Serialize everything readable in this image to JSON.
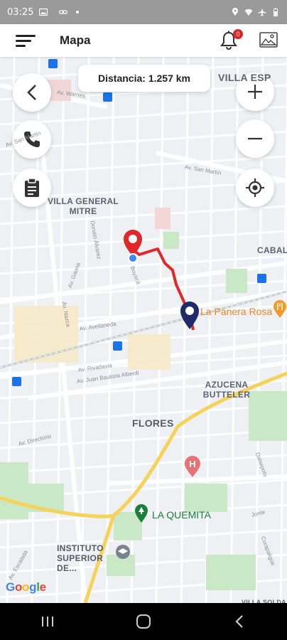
{
  "status_bar": {
    "time": "03:25"
  },
  "app_bar": {
    "title": "Mapa",
    "notification_count": "0"
  },
  "map": {
    "distance_text": "Distancia: 1.257 km",
    "areas": {
      "villa_general_mitre": "VILLA GENERAL MITRE",
      "villa_esp": "VILLA ESP",
      "caball": "CABALL",
      "azucena_butteler": "AZUCENA BUTTELER",
      "flores": "FLORES",
      "instituto": "INSTITUTO SUPERIOR DE...",
      "villa_sold": "VILLA SOLDA"
    },
    "pois": {
      "la_panera_rosa": "La Panera Rosa",
      "la_quemita": "LA QUEMITA"
    },
    "streets": {
      "warnes": "Av. Warnes",
      "san_martin_1": "Av. San Martín",
      "san_martin_2": "Av. San Martín",
      "gaona": "Av. Gaona",
      "avellaneda": "Av. Avellaneda",
      "rivadavia": "Av. Rivadavia",
      "alberdi": "Av. Juan Bautista Alberdi",
      "directorio": "Av. Directorio",
      "nazca": "Av. Nazca",
      "donato": "Donato Álvarez",
      "dalsepolo": "Dalsepolo",
      "escalada": "Av. Escalada",
      "jonte": "Jonte",
      "curapaligue": "Curapaligüe",
      "boyaca": "Boyacá"
    },
    "attribution": "Google"
  },
  "colors": {
    "route": "#e0272a",
    "origin_pin": "#e0272a",
    "destination_pin": "#1f2a6b",
    "major_road": "#f5d35a",
    "park": "#c7e6c2",
    "transit": "#1a73e8"
  },
  "icons": {
    "menu": "menu-icon",
    "bell": "bell-icon",
    "image": "image-icon",
    "back": "chevron-left-icon",
    "phone": "phone-icon",
    "clipboard": "clipboard-icon",
    "zoom_in": "plus-icon",
    "zoom_out": "minus-icon",
    "locate": "my-location-icon"
  }
}
